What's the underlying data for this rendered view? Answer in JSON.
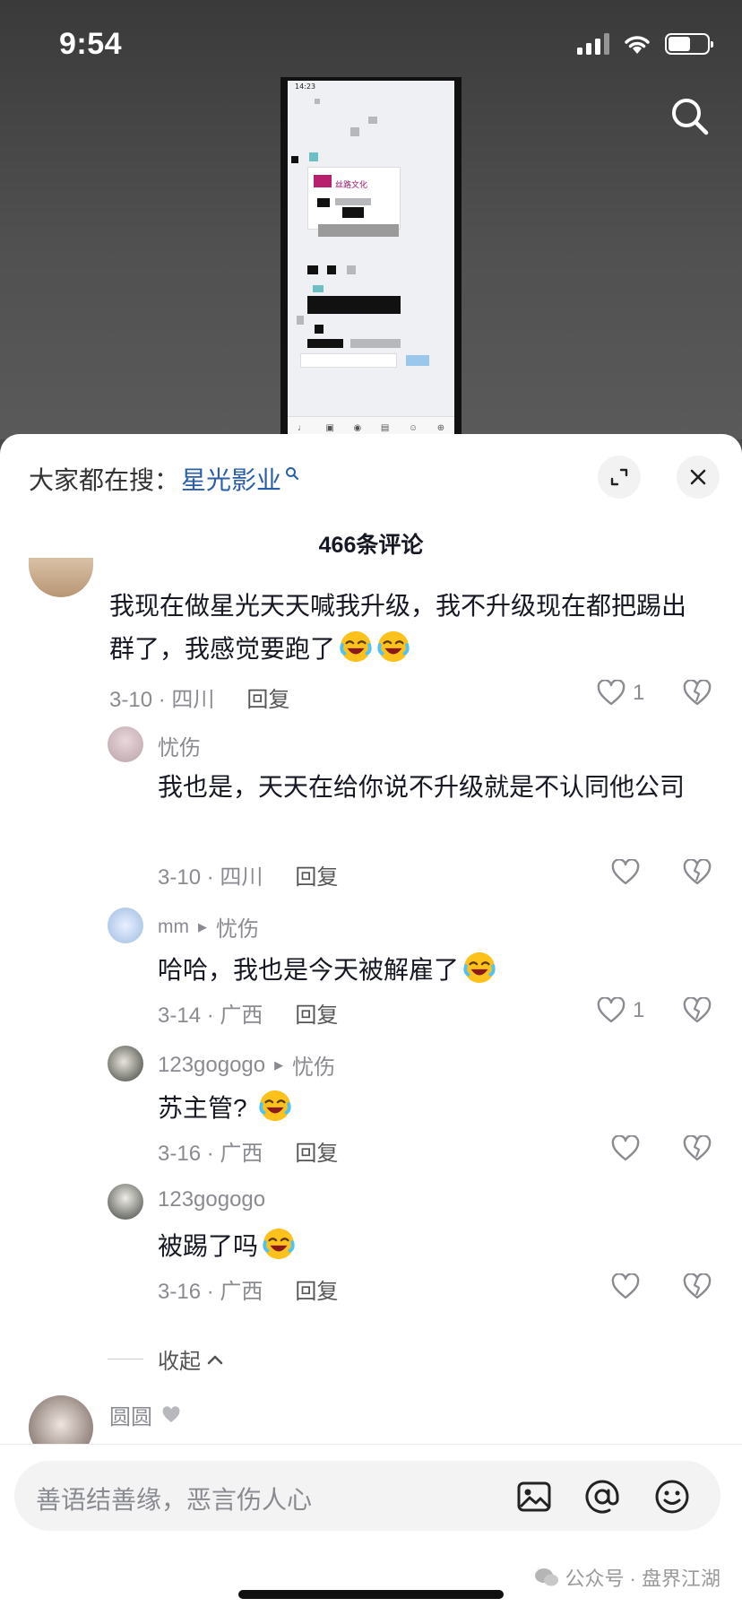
{
  "status_bar": {
    "time": "9:54"
  },
  "inner_screenshot": {
    "time": "14:23",
    "card_title": "丝路文化"
  },
  "panel": {
    "hot_search_prefix": "大家都在搜：",
    "hot_search_keyword": "星光影业",
    "comment_count": "466条评论"
  },
  "comments": [
    {
      "text": "我现在做星光天天喊我升级，我不升级现在都把踢出群了，我感觉要跑了",
      "date": "3-10 · 四川",
      "reply": "回复",
      "likes": "1"
    },
    {
      "name": "忧伤",
      "text": "我也是，天天在给你说不升级就是不认同他公司",
      "date": "3-10 · 四川",
      "reply": "回复"
    },
    {
      "name": "mm",
      "reply_to": "忧伤",
      "text": "哈哈，我也是今天被解雇了",
      "date": "3-14 · 广西",
      "reply": "回复",
      "likes": "1"
    },
    {
      "name": "123gogogo",
      "reply_to": "忧伤",
      "text": "苏主管?",
      "date": "3-16 · 广西",
      "reply": "回复"
    },
    {
      "name": "123gogogo",
      "text": "被踢了吗",
      "date": "3-16 · 广西",
      "reply": "回复"
    },
    {
      "name": "圆圆"
    }
  ],
  "collapse_label": "收起",
  "input": {
    "placeholder": "善语结善缘，恶言伤人心"
  },
  "watermark": "公众号 · 盘界江湖",
  "icons": [
    "search-icon",
    "expand-icon",
    "close-icon",
    "heart-icon",
    "broken-heart-icon",
    "laugh-cry-emoji",
    "image-icon",
    "at-icon",
    "emoji-icon",
    "wechat-icon"
  ]
}
